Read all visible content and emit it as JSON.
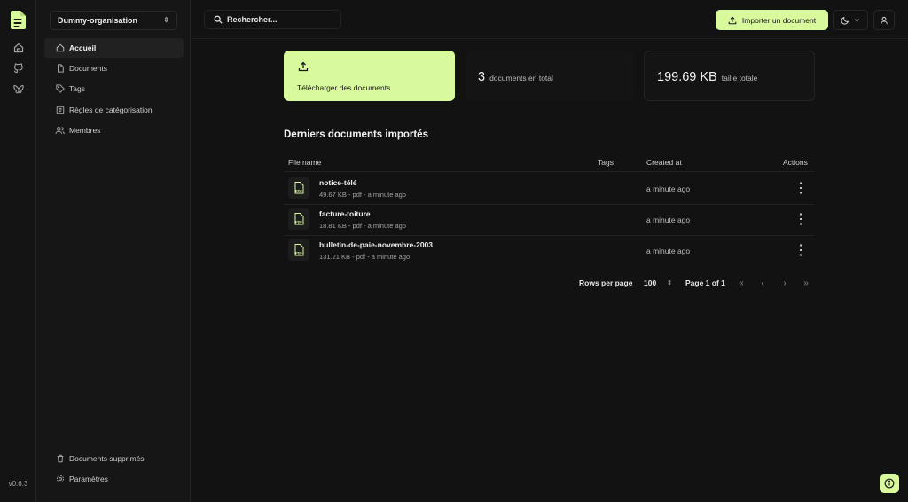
{
  "app": {
    "version": "v0.6.3"
  },
  "rail": {
    "icons": [
      "home-icon",
      "github-icon",
      "bluesky-icon"
    ]
  },
  "sidebar": {
    "org": "Dummy-organisation",
    "items": [
      {
        "label": "Accueil",
        "icon": "home-icon",
        "active": true
      },
      {
        "label": "Documents",
        "icon": "file-icon"
      },
      {
        "label": "Tags",
        "icon": "tag-icon"
      },
      {
        "label": "Règles de catégorisation",
        "icon": "rules-icon"
      },
      {
        "label": "Membres",
        "icon": "users-icon"
      }
    ],
    "bottom": [
      {
        "label": "Documents supprimés",
        "icon": "trash-icon"
      },
      {
        "label": "Paramètres",
        "icon": "gear-icon"
      }
    ]
  },
  "topbar": {
    "search_placeholder": "Rechercher...",
    "import_label": "Importer un document"
  },
  "cards": {
    "upload_label": "Télécharger des documents",
    "doc_count": "3",
    "doc_count_label": "documents en total",
    "total_size": "199.69 KB",
    "total_size_label": "taille totale"
  },
  "recent": {
    "title": "Derniers documents importés",
    "columns": {
      "file": "File name",
      "tags": "Tags",
      "created": "Created at",
      "actions": "Actions"
    },
    "rows": [
      {
        "name": "notice-télé",
        "meta": "49.67 KB - pdf - a minute ago",
        "created": "a minute ago"
      },
      {
        "name": "facture-toiture",
        "meta": "18.81 KB - pdf - a minute ago",
        "created": "a minute ago"
      },
      {
        "name": "bulletin-de-paie-novembre-2003",
        "meta": "131.21 KB - pdf - a minute ago",
        "created": "a minute ago"
      }
    ]
  },
  "pagination": {
    "rows_per_page_label": "Rows per page",
    "rows_per_page": "100",
    "page_info": "Page 1 of 1"
  },
  "colors": {
    "accent": "#d9f99d",
    "background": "#121212"
  }
}
